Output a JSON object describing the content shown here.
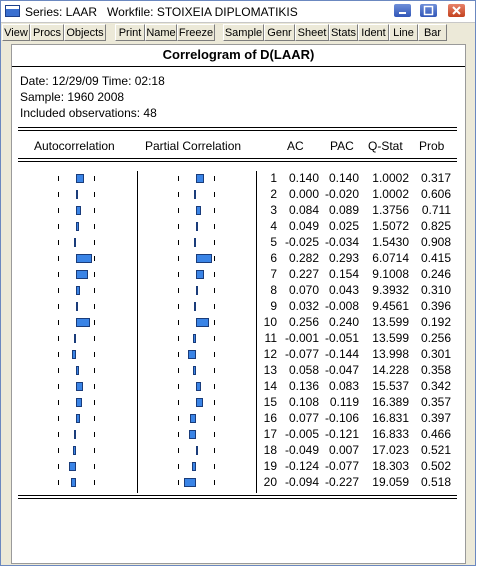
{
  "window": {
    "title": "Series: LAAR   Workfile: STOIXEIA DIPLOMATIKIS",
    "buttons": [
      "minimize-button",
      "maximize-button",
      "close-button"
    ]
  },
  "toolbar": {
    "buttons": [
      "View",
      "Procs",
      "Objects",
      "Print",
      "Name",
      "Freeze",
      "Sample",
      "Genr",
      "Sheet",
      "Stats",
      "Ident",
      "Line",
      "Bar"
    ]
  },
  "correlogram": {
    "title": "Correlogram of D(LAAR)",
    "date_line": "Date: 12/29/09   Time: 02:18",
    "sample_line": "Sample: 1960 2008",
    "obs_line": "Included observations: 48",
    "headers": {
      "autocorrelation": "Autocorrelation",
      "partial_correlation": "Partial Correlation",
      "ac": "AC",
      "pac": "PAC",
      "qstat": "Q-Stat",
      "prob": "Prob"
    },
    "rows": [
      {
        "lag": "1",
        "ac": "0.140",
        "pac": "0.140",
        "q": "1.0002",
        "prob": "0.317"
      },
      {
        "lag": "2",
        "ac": "0.000",
        "pac": "-0.020",
        "q": "1.0002",
        "prob": "0.606"
      },
      {
        "lag": "3",
        "ac": "0.084",
        "pac": "0.089",
        "q": "1.3756",
        "prob": "0.711"
      },
      {
        "lag": "4",
        "ac": "0.049",
        "pac": "0.025",
        "q": "1.5072",
        "prob": "0.825"
      },
      {
        "lag": "5",
        "ac": "-0.025",
        "pac": "-0.034",
        "q": "1.5430",
        "prob": "0.908"
      },
      {
        "lag": "6",
        "ac": "0.282",
        "pac": "0.293",
        "q": "6.0714",
        "prob": "0.415"
      },
      {
        "lag": "7",
        "ac": "0.227",
        "pac": "0.154",
        "q": "9.1008",
        "prob": "0.246"
      },
      {
        "lag": "8",
        "ac": "0.070",
        "pac": "0.043",
        "q": "9.3932",
        "prob": "0.310"
      },
      {
        "lag": "9",
        "ac": "0.032",
        "pac": "-0.008",
        "q": "9.4561",
        "prob": "0.396"
      },
      {
        "lag": "10",
        "ac": "0.256",
        "pac": "0.240",
        "q": "13.599",
        "prob": "0.192"
      },
      {
        "lag": "11",
        "ac": "-0.001",
        "pac": "-0.051",
        "q": "13.599",
        "prob": "0.256"
      },
      {
        "lag": "12",
        "ac": "-0.077",
        "pac": "-0.144",
        "q": "13.998",
        "prob": "0.301"
      },
      {
        "lag": "13",
        "ac": "0.058",
        "pac": "-0.047",
        "q": "14.228",
        "prob": "0.358"
      },
      {
        "lag": "14",
        "ac": "0.136",
        "pac": "0.083",
        "q": "15.537",
        "prob": "0.342"
      },
      {
        "lag": "15",
        "ac": "0.108",
        "pac": "0.119",
        "q": "16.389",
        "prob": "0.357"
      },
      {
        "lag": "16",
        "ac": "0.077",
        "pac": "-0.106",
        "q": "16.831",
        "prob": "0.397"
      },
      {
        "lag": "17",
        "ac": "-0.005",
        "pac": "-0.121",
        "q": "16.833",
        "prob": "0.466"
      },
      {
        "lag": "18",
        "ac": "-0.049",
        "pac": "0.007",
        "q": "17.023",
        "prob": "0.521"
      },
      {
        "lag": "19",
        "ac": "-0.124",
        "pac": "-0.077",
        "q": "18.303",
        "prob": "0.502"
      },
      {
        "lag": "20",
        "ac": "-0.094",
        "pac": "-0.227",
        "q": "19.059",
        "prob": "0.518"
      }
    ]
  },
  "colors": {
    "bar_fill": "#3a84e6",
    "window_frame": "#ece9d8",
    "close_button": "#c3421e",
    "title_buttons": "#3156b8"
  }
}
